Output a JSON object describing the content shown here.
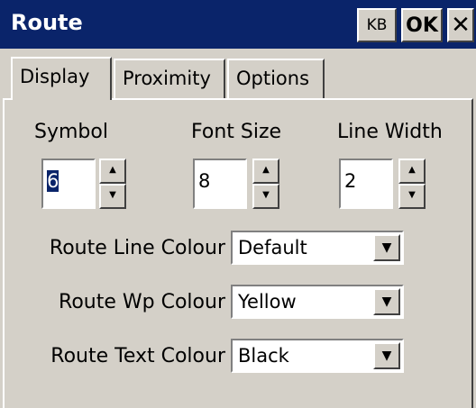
{
  "window": {
    "title": "Route",
    "kb_label": "KB",
    "ok_label": "OK",
    "close_label": "✕"
  },
  "tabs": [
    {
      "label": "Display",
      "active": true
    },
    {
      "label": "Proximity",
      "active": false
    },
    {
      "label": "Options",
      "active": false
    }
  ],
  "fields": {
    "symbol": {
      "label": "Symbol",
      "value": "6"
    },
    "font_size": {
      "label": "Font Size",
      "value": "8"
    },
    "line_width": {
      "label": "Line Width",
      "value": "2"
    }
  },
  "dropdowns": {
    "route_line_colour": {
      "label": "Route Line Colour",
      "value": "Default"
    },
    "route_wp_colour": {
      "label": "Route Wp Colour",
      "value": "Yellow"
    },
    "route_text_colour": {
      "label": "Route Text Colour",
      "value": "Black"
    }
  },
  "icons": {
    "up": "▲",
    "down": "▼"
  },
  "colors": {
    "titlebar": "#0a246a",
    "face": "#d4d0c8"
  }
}
